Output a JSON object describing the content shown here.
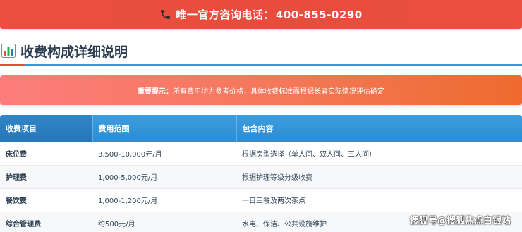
{
  "banner": {
    "label": "唯一官方咨询电话：",
    "phone": "400-855-0290"
  },
  "section": {
    "title": "收费构成详细说明"
  },
  "notice": {
    "label": "重要提示：",
    "text": "所有费用均为参考价格，具体收费标准需根据长者实际情况评估确定"
  },
  "table": {
    "headers": [
      "收费项目",
      "费用范围",
      "包含内容"
    ],
    "rows": [
      [
        "床位费",
        "3,500-10,000元/月",
        "根据房型选择（单人间、双人间、三人间）"
      ],
      [
        "护理费",
        "1,000-5,000元/月",
        "根据护理等级分级收费"
      ],
      [
        "餐饮费",
        "1,000-1,200元/月",
        "一日三餐及两次茶点"
      ],
      [
        "综合管理费",
        "约500元/月",
        "水电、保洁、公共设施维护"
      ]
    ]
  },
  "watermark": "搜狐号@搜狐焦点白银站",
  "colors": {
    "banner": "#e74c3c",
    "accent_blue": "#3498db",
    "header_blue": "#2e8bd0"
  }
}
